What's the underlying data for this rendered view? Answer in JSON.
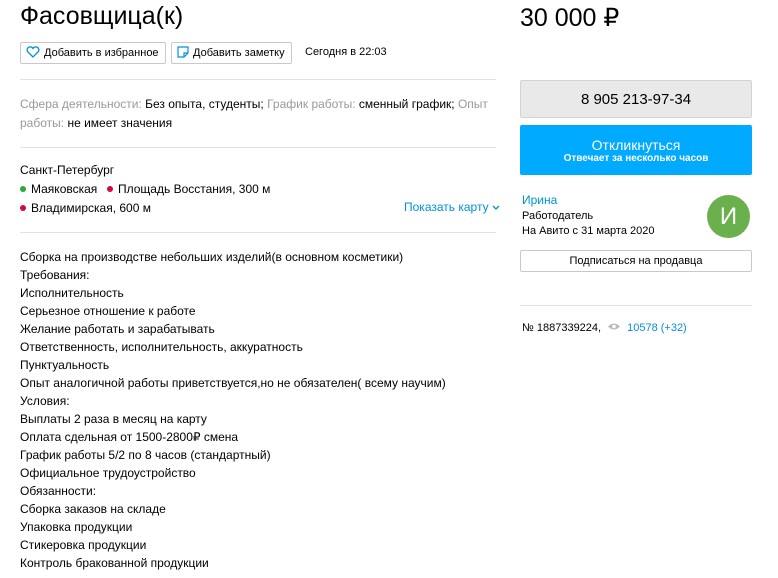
{
  "ad": {
    "title": "Фасовщица(к)",
    "price": "30 000 ₽",
    "actions": {
      "favorite_label": "Добавить в избранное",
      "note_label": "Добавить заметку"
    },
    "posted": "Сегодня в 22:03",
    "params": [
      {
        "label": "Сфера деятельности:",
        "value": "Без опыта, студенты;"
      },
      {
        "label": "График работы:",
        "value": "сменный график;"
      },
      {
        "label": "Опыт работы:",
        "value": "не имеет значения"
      }
    ],
    "location": {
      "city": "Санкт-Петербург",
      "metro": [
        {
          "name": "Маяковская",
          "distance": "",
          "color": "#2ea836"
        },
        {
          "name": "Площадь Восстания",
          "distance": ", 300 м",
          "color": "#d6083b"
        },
        {
          "name": "Владимирская",
          "distance": ", 600 м",
          "color": "#d6083b"
        }
      ],
      "show_map_label": "Показать карту"
    },
    "description": [
      "Сборка на производстве небольших изделий(в основном косметики)",
      "Требования:",
      "Исполнительность",
      "Серьезное отношение к работе",
      "Желание работать и зарабатывать",
      "Ответственность, исполнительность, аккуратность",
      "Пунктуальность",
      "Опыт аналогичной работы приветствуется,но не обязателен( всему научим)",
      "Условия:",
      "Выплаты 2 раза в месяц на карту",
      "Оплата сдельная от 1500-2800₽ смена",
      "График работы 5/2 по 8 часов (стандартный)",
      "Официальное трудоустройство",
      "Обязанности:",
      "Сборка заказов на складе",
      "Упаковка продукции",
      "Стикеровка продукции",
      "Контроль бракованной продукции"
    ]
  },
  "sidebar": {
    "phone": "8 905 213-97-34",
    "respond_label": "Откликнуться",
    "respond_sub": "Отвечает за несколько часов",
    "seller": {
      "name": "Ирина",
      "role": "Работодатель",
      "since": "На Авито с 31 марта 2020",
      "avatar_letter": "И",
      "avatar_color": "#6ab04c"
    },
    "subscribe_label": "Подписаться на продавца",
    "ad_number": "№ 1887339224,",
    "views": "10578 (+32)"
  },
  "colors": {
    "accent": "#00aaff",
    "link": "#0091d9"
  }
}
